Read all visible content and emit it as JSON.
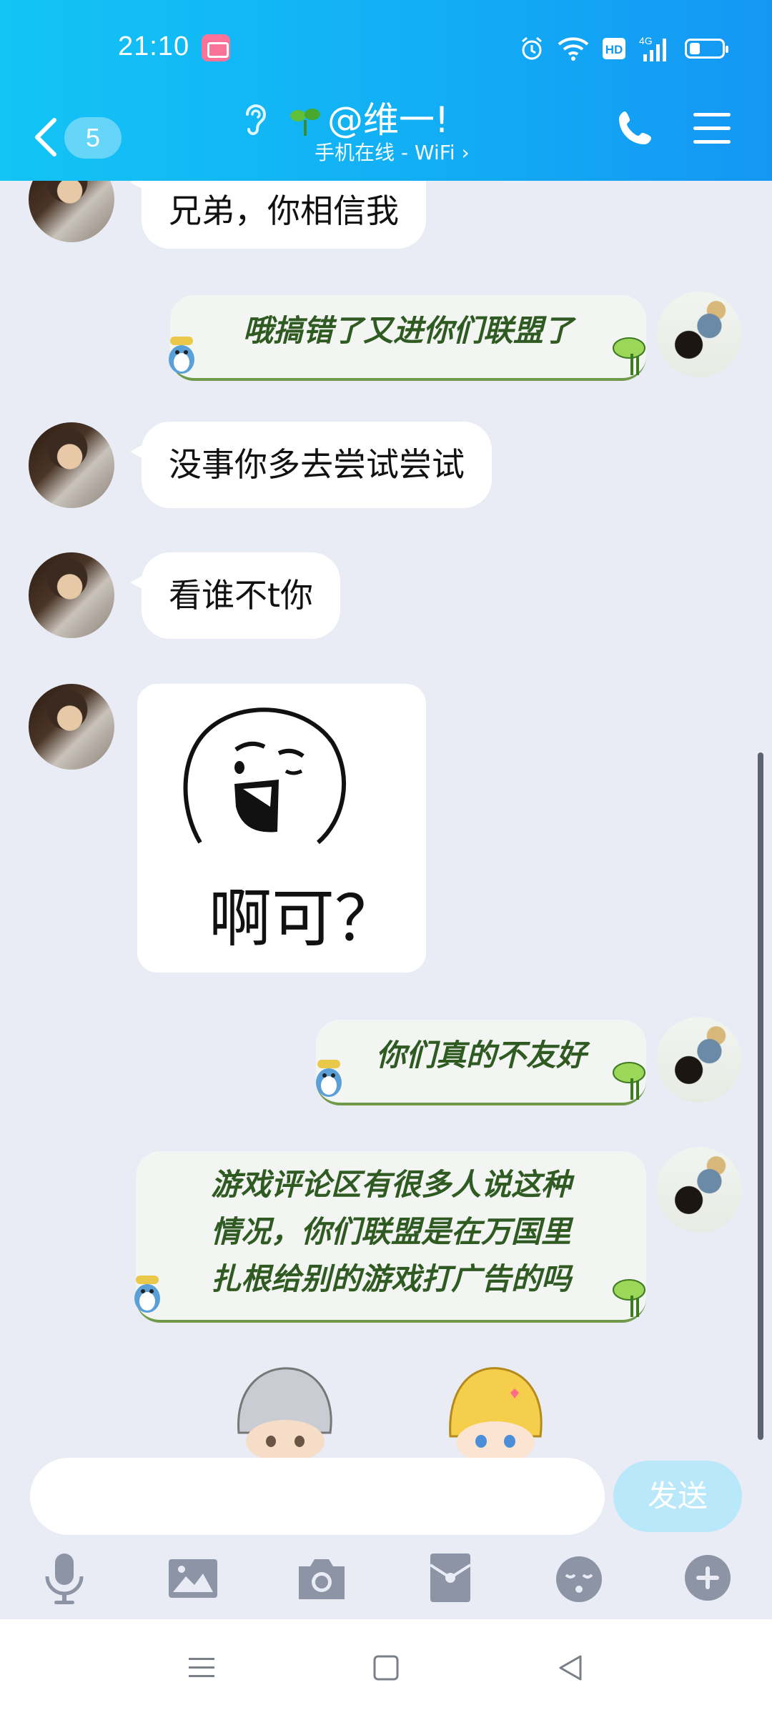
{
  "status_bar": {
    "time": "21:10",
    "network": "4G",
    "hd": "HD"
  },
  "header": {
    "unread_count": "5",
    "contact_name": "@维一!",
    "contact_status": "手机在线 - WiFi ›"
  },
  "messages": [
    {
      "side": "left",
      "type": "text",
      "text": "兄弟，你相信我"
    },
    {
      "side": "right",
      "type": "text",
      "text": "哦搞错了又进你们联盟了"
    },
    {
      "side": "left",
      "type": "text",
      "text": "没事你多去尝试尝试"
    },
    {
      "side": "left",
      "type": "text",
      "text": "看谁不t你"
    },
    {
      "side": "left",
      "type": "sticker",
      "text": "啊可？"
    },
    {
      "side": "right",
      "type": "text",
      "text": "你们真的不友好"
    },
    {
      "side": "right",
      "type": "text",
      "lines": [
        "游戏评论区有很多人说这种",
        "情况，你们联盟是在万国里",
        "扎根给别的游戏打广告的吗"
      ]
    }
  ],
  "input": {
    "placeholder": "",
    "send_label": "发送"
  },
  "toolbar": {
    "icons": [
      "microphone-icon",
      "image-icon",
      "camera-icon",
      "red-packet-icon",
      "emoji-icon",
      "plus-icon"
    ]
  },
  "colors": {
    "header_start": "#13c4f5",
    "header_end": "#1497f4",
    "background": "#e9ecf5",
    "green_text": "#2f5a22",
    "send_disabled": "#b9e8fb"
  }
}
